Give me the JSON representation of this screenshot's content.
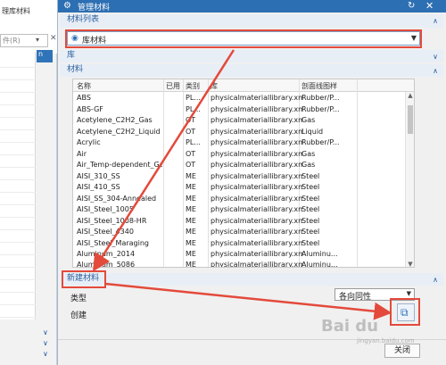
{
  "left_app": {
    "title": "理库材料",
    "filter_placeholder": "件(R)",
    "tab_label": "n"
  },
  "dialog": {
    "title": "管理材料",
    "sections": {
      "material_list": "材料列表",
      "library": "库",
      "materials": "材料",
      "new_material": "新建材料"
    },
    "library_select": "库材料",
    "table": {
      "headers": [
        "名称",
        "已用",
        "类别",
        "库",
        "剖面线图样"
      ],
      "rows": [
        [
          "ABS",
          "",
          "PL...",
          "physicalmateriallibrary.xml",
          "Rubber/P..."
        ],
        [
          "ABS-GF",
          "",
          "PL...",
          "physicalmateriallibrary.xml",
          "Rubber/P..."
        ],
        [
          "Acetylene_C2H2_Gas",
          "",
          "OT",
          "physicalmateriallibrary.xml",
          "Gas"
        ],
        [
          "Acetylene_C2H2_Liquid",
          "",
          "OT",
          "physicalmateriallibrary.xml",
          "Liquid"
        ],
        [
          "Acrylic",
          "",
          "PL...",
          "physicalmateriallibrary.xml",
          "Rubber/P..."
        ],
        [
          "Air",
          "",
          "OT",
          "physicalmateriallibrary.xml",
          "Gas"
        ],
        [
          "Air_Temp-dependent_Gas",
          "",
          "OT",
          "physicalmateriallibrary.xml",
          "Gas"
        ],
        [
          "AISI_310_SS",
          "",
          "ME",
          "physicalmateriallibrary.xml",
          "Steel"
        ],
        [
          "AISI_410_SS",
          "",
          "ME",
          "physicalmateriallibrary.xml",
          "Steel"
        ],
        [
          "AISI_SS_304-Annealed",
          "",
          "ME",
          "physicalmateriallibrary.xml",
          "Steel"
        ],
        [
          "AISI_Steel_1005",
          "",
          "ME",
          "physicalmateriallibrary.xml",
          "Steel"
        ],
        [
          "AISI_Steel_1008-HR",
          "",
          "ME",
          "physicalmateriallibrary.xml",
          "Steel"
        ],
        [
          "AISI_Steel_4340",
          "",
          "ME",
          "physicalmateriallibrary.xml",
          "Steel"
        ],
        [
          "AISI_Steel_Maraging",
          "",
          "ME",
          "physicalmateriallibrary.xml",
          "Steel"
        ],
        [
          "Aluminum_2014",
          "",
          "ME",
          "physicalmateriallibrary.xml",
          "Aluminu..."
        ],
        [
          "Aluminum_5086",
          "",
          "ME",
          "physicalmateriallibrary.xml",
          "Aluminu..."
        ]
      ]
    },
    "type_label": "类型",
    "type_value": "各向同性",
    "create_label": "创建",
    "close_button": "关闭"
  },
  "watermark": {
    "brand": "Bai du",
    "sub": "jingyan.baidu.com"
  },
  "colors": {
    "titlebar": "#2d6fb3",
    "annotation": "#e34a3b",
    "section_text": "#2a5fa0"
  },
  "icons": [
    "gear-icon",
    "refresh-icon",
    "close-icon",
    "library-icon",
    "chevron-up-icon",
    "chevron-down-icon",
    "create-material-icon"
  ]
}
